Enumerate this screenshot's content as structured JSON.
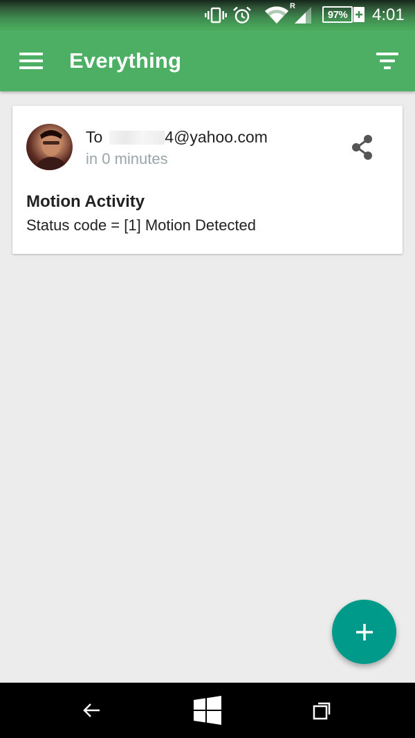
{
  "status_bar": {
    "icons": [
      "vibrate-icon",
      "alarm-icon",
      "wifi-icon",
      "signal-icon"
    ],
    "roaming_indicator": "R",
    "battery": "97%",
    "time": "4:01"
  },
  "app_bar": {
    "title": "Everything",
    "menu_icon": "hamburger-menu-icon",
    "filter_icon": "filter-icon"
  },
  "card": {
    "recipient_prefix": "To",
    "recipient_email_suffix": "4@yahoo.com",
    "timing": "in 0 minutes",
    "title": "Motion Activity",
    "body": "Status code = [1] Motion Detected",
    "share_icon": "share-icon"
  },
  "fab": {
    "icon": "plus-icon"
  },
  "nav_bar": {
    "icons": [
      "back-icon",
      "windows-home-icon",
      "recent-apps-icon"
    ]
  },
  "colors": {
    "primary": "#4caf63",
    "accent": "#009a8a",
    "background": "#ececec",
    "secondary_text": "#99a5aa"
  }
}
